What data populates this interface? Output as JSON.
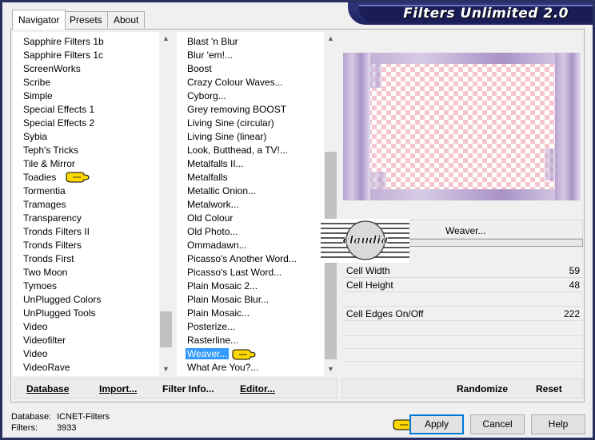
{
  "app": {
    "title": "Filters Unlimited 2.0"
  },
  "tabs": [
    {
      "label": "Navigator",
      "active": true
    },
    {
      "label": "Presets",
      "active": false
    },
    {
      "label": "About",
      "active": false
    }
  ],
  "categories": {
    "items": [
      "Sapphire Filters 1b",
      "Sapphire Filters 1c",
      "ScreenWorks",
      "Scribe",
      "Simple",
      "Special Effects 1",
      "Special Effects 2",
      "Sybia",
      "Teph's Tricks",
      "Tile & Mirror",
      "Toadies",
      "Tormentia",
      "Tramages",
      "Transparency",
      "Tronds Filters II",
      "Tronds Filters",
      "Tronds First",
      "Two Moon",
      "Tymoes",
      "UnPlugged Colors",
      "UnPlugged Tools",
      "Video",
      "Videofilter",
      "Video",
      "VideoRave"
    ],
    "selected": "Toadies"
  },
  "filters": {
    "items": [
      "Blast 'n Blur",
      "Blur 'em!...",
      "Boost",
      "Crazy Colour Waves...",
      "Cyborg...",
      "Grey removing BOOST",
      "Living Sine (circular)",
      "Living Sine (linear)",
      "Look, Butthead, a TV!...",
      "Metalfalls II...",
      "Metalfalls",
      "Metallic Onion...",
      "Metalwork...",
      "Old Colour",
      "Old Photo...",
      "Ommadawn...",
      "Picasso's Another Word...",
      "Picasso's Last Word...",
      "Plain Mosaic 2...",
      "Plain Mosaic Blur...",
      "Plain Mosaic...",
      "Posterize...",
      "Rasterline...",
      "Weaver...",
      "What Are You?..."
    ],
    "selected": "Weaver..."
  },
  "filter_panel": {
    "name": "Weaver...",
    "params": [
      {
        "label": "Cell Width",
        "value": "59"
      },
      {
        "label": "Cell Height",
        "value": "48"
      },
      {
        "label": "Cell Edges On/Off",
        "value": "222"
      }
    ]
  },
  "watermark": {
    "text": "claudia"
  },
  "toolbar_left": {
    "database": "Database",
    "import": "Import...",
    "filter_info": "Filter Info...",
    "editor": "Editor..."
  },
  "toolbar_right": {
    "randomize": "Randomize",
    "reset": "Reset"
  },
  "status": {
    "database_label": "Database:",
    "database_value": "ICNET-Filters",
    "filters_label": "Filters:",
    "filters_value": "3933"
  },
  "dialog_buttons": {
    "apply": "Apply",
    "cancel": "Cancel",
    "help": "Help"
  },
  "colors": {
    "selection": "#3399ff",
    "banner": "#1a1d55",
    "checker": "#f5c6cf",
    "pointer": "#ffd800"
  },
  "icons": {
    "pointer": "pointing-hand-icon",
    "scroll_up": "chevron-up-icon",
    "scroll_down": "chevron-down-icon"
  }
}
